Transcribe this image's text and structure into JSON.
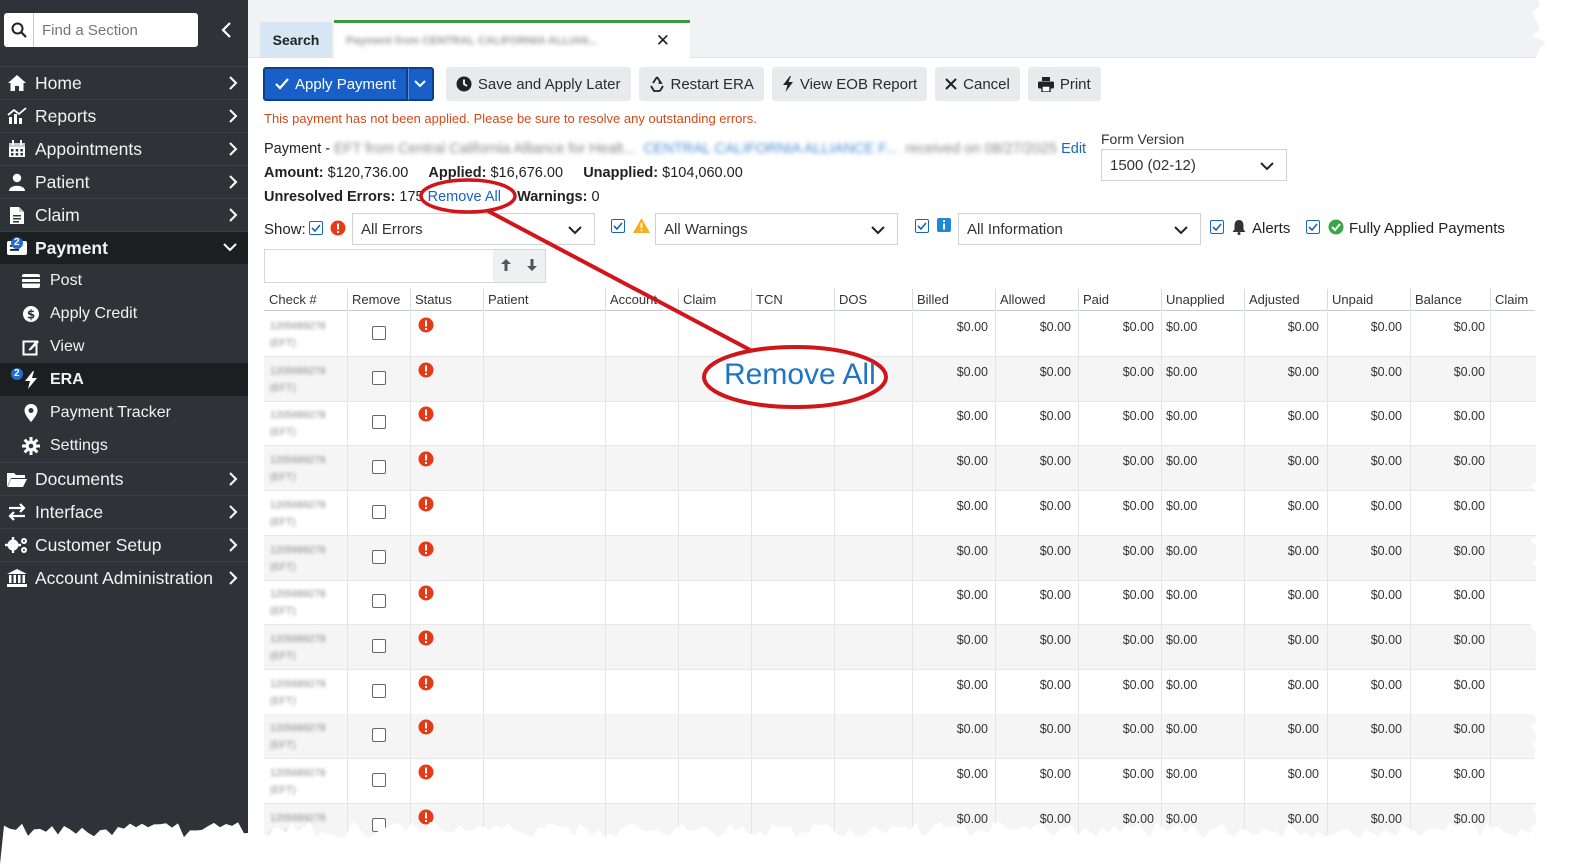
{
  "sidebar": {
    "search_placeholder": "Find a Section",
    "items": [
      {
        "label": "Home",
        "icon": "home-icon"
      },
      {
        "label": "Reports",
        "icon": "reports-icon"
      },
      {
        "label": "Appointments",
        "icon": "calendar-icon"
      },
      {
        "label": "Patient",
        "icon": "user-icon"
      },
      {
        "label": "Claim",
        "icon": "document-icon"
      },
      {
        "label": "Payment",
        "icon": "payment-icon",
        "active": true,
        "badge": "2"
      },
      {
        "label": "Documents",
        "icon": "folder-icon"
      },
      {
        "label": "Interface",
        "icon": "swap-icon"
      },
      {
        "label": "Customer Setup",
        "icon": "gears-icon"
      },
      {
        "label": "Account Administration",
        "icon": "bank-icon"
      }
    ],
    "payment_sub": [
      {
        "label": "Post",
        "icon": "post-icon"
      },
      {
        "label": "Apply Credit",
        "icon": "dollar-icon"
      },
      {
        "label": "View",
        "icon": "edit-icon"
      },
      {
        "label": "ERA",
        "icon": "bolt-icon",
        "active": true,
        "badge": "2"
      },
      {
        "label": "Payment Tracker",
        "icon": "pin-icon"
      },
      {
        "label": "Settings",
        "icon": "gear-icon"
      }
    ]
  },
  "tabs": {
    "search": "Search",
    "payment": "Payment from CENTRAL CALIFORNIA ALLIAN..."
  },
  "toolbar": {
    "apply": "Apply Payment",
    "save_later": "Save and Apply Later",
    "restart": "Restart ERA",
    "eob": "View EOB Report",
    "cancel": "Cancel",
    "print": "Print"
  },
  "notice": "This payment has not been applied. Please be sure to resolve any outstanding errors.",
  "payment_info": {
    "prefix": "Payment -",
    "eft_text": "EFT from Central California Alliance for Healt...",
    "payer_link": "CENTRAL CALIFORNIA ALLIANCE F...",
    "received": "received on 08/27/2025",
    "edit": "Edit",
    "amount_label": "Amount:",
    "amount": "$120,736.00",
    "applied_label": "Applied:",
    "applied": "$16,676.00",
    "unapplied_label": "Unapplied:",
    "unapplied": "$104,060.00",
    "unresolved_label": "Unresolved Errors:",
    "unresolved": "175",
    "remove_all": "Remove All",
    "warnings_label": "Warnings:",
    "warnings": "0"
  },
  "form_version": {
    "label": "Form Version",
    "value": "1500 (02-12)"
  },
  "filters": {
    "show": "Show:",
    "errors": "All Errors",
    "warnings": "All Warnings",
    "information": "All Information",
    "alerts": "Alerts",
    "fully_applied": "Fully Applied Payments"
  },
  "grid": {
    "headers": [
      "Check #",
      "Remove",
      "Status",
      "Patient",
      "Account",
      "Claim",
      "TCN",
      "DOS",
      "Billed",
      "Allowed",
      "Paid",
      "Unapplied",
      "Adjusted",
      "Unpaid",
      "Balance",
      "Claim"
    ],
    "check_value": "1205689278",
    "check_type": "(EFT)",
    "money": "$0.00",
    "row_count": 12
  },
  "callout": {
    "text": "Remove All",
    "color": "#d0161b"
  }
}
